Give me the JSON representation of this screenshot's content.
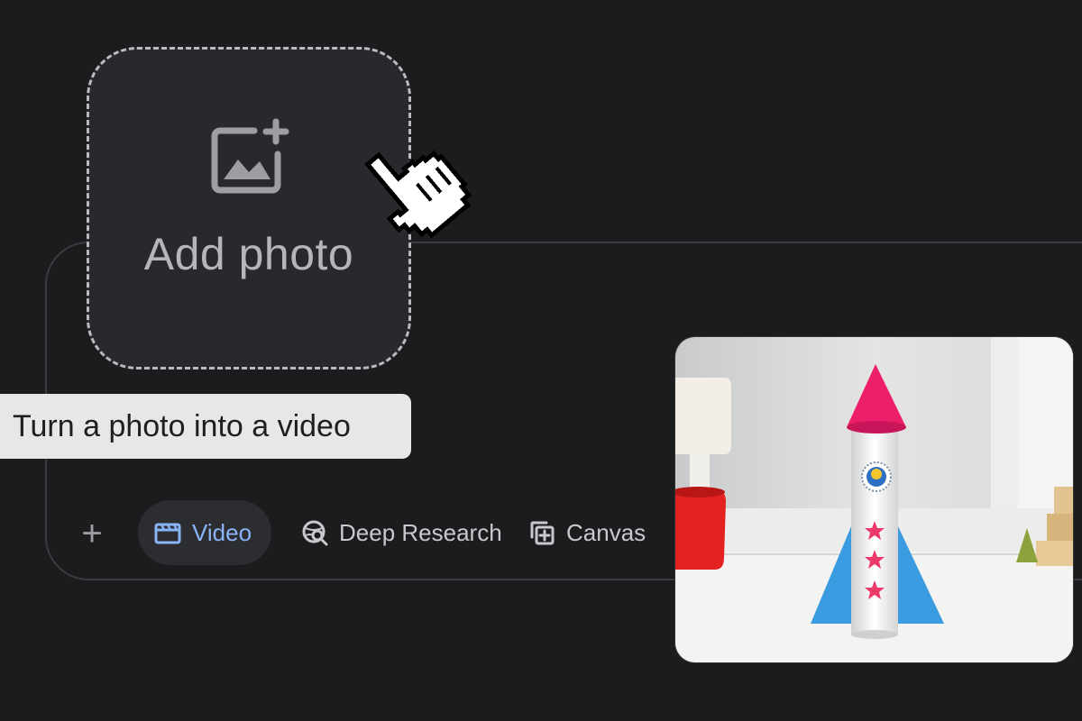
{
  "dropzone": {
    "label": "Add photo",
    "icon": "add-photo-icon"
  },
  "tooltip": {
    "text": "Turn a photo into a video"
  },
  "toolbar": {
    "plus_label": "+",
    "video_label": "Video",
    "deep_research_label": "Deep Research",
    "canvas_label": "Canvas"
  },
  "colors": {
    "background": "#1b1c1e",
    "accent": "#8ab4f8",
    "tooltip_bg": "#e6e7e9"
  }
}
